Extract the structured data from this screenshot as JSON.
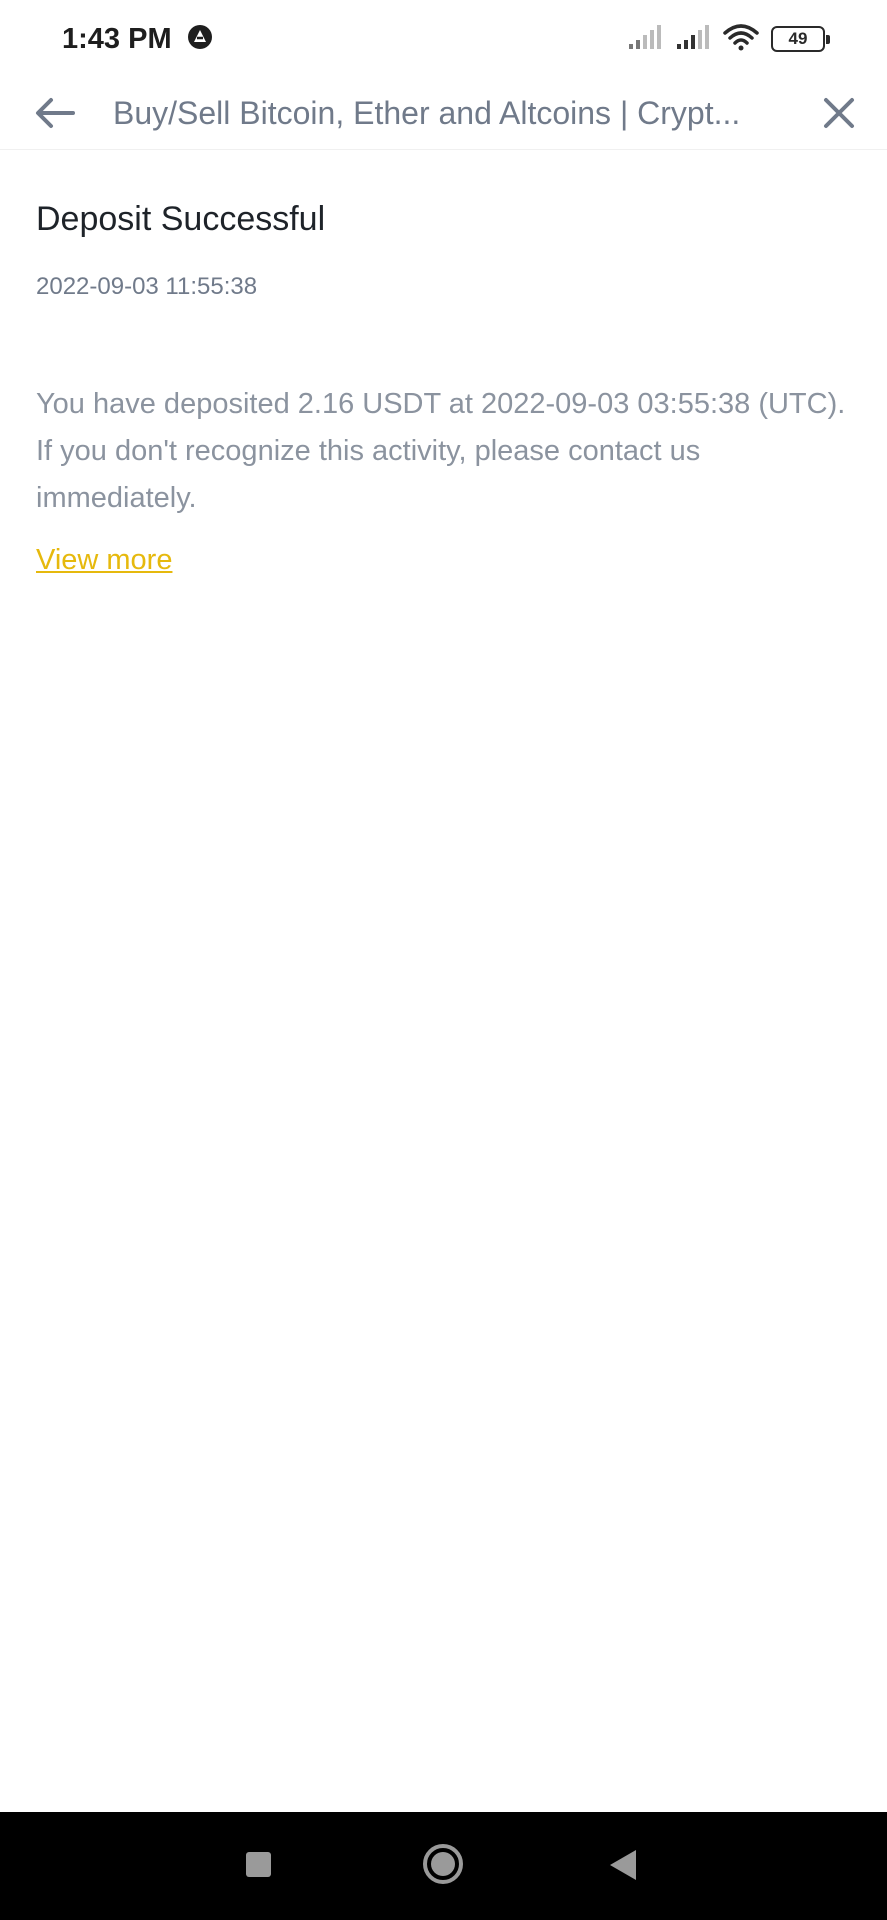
{
  "status_bar": {
    "time": "1:43 PM",
    "battery": "49",
    "icons": [
      "notification-app-icon",
      "signal-1-icon",
      "signal-2-icon",
      "wifi-icon",
      "battery-icon"
    ]
  },
  "header": {
    "title": "Buy/Sell Bitcoin, Ether and Altcoins | Crypt...",
    "back_icon": "arrow-left-icon",
    "close_icon": "close-icon"
  },
  "notice": {
    "title": "Deposit Successful",
    "date": "2022-09-03 11:55:38",
    "line1": "You have deposited 2.16 USDT at 2022-09-03 03:55:38 (UTC).",
    "line2": "If you don't recognize this activity, please contact us immediately.",
    "link": "View more"
  },
  "colors": {
    "link": "#e6b90d",
    "text_primary": "#1e2329",
    "text_secondary": "#707a8a"
  },
  "nav_bar": {
    "icons": [
      "recent-apps-icon",
      "home-icon",
      "back-icon"
    ]
  }
}
